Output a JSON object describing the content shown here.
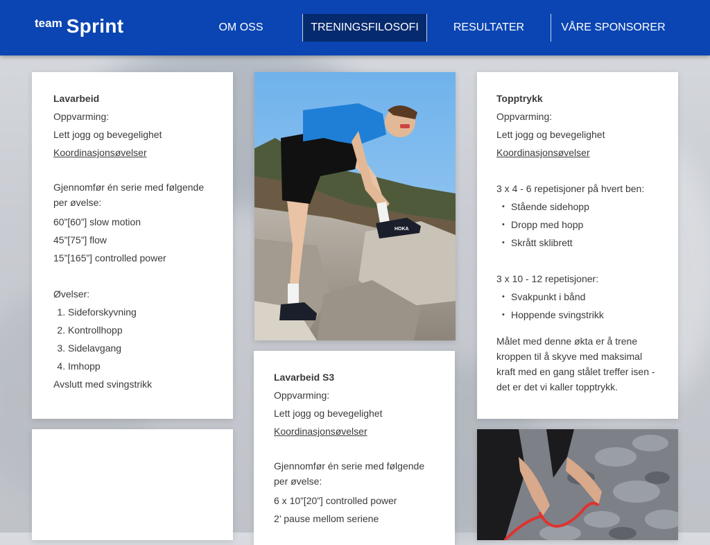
{
  "logo": {
    "team": "team",
    "sprint": "Sprint"
  },
  "nav": [
    {
      "label": "OM OSS"
    },
    {
      "label": "TRENINGSFILOSOFI"
    },
    {
      "label": "RESULTATER"
    },
    {
      "label": "VÅRE SPONSORER"
    }
  ],
  "card_left": {
    "title": "Lavarbeid",
    "warmup_label": "Oppvarming:",
    "warmup_text": "Lett jogg og bevegelighet",
    "link": "Koordinasjonsøvelser",
    "series_intro": "Gjennomfør én serie med følgende per øvelse:",
    "lines": [
      "60”[60”] slow motion",
      "45”[75”] flow",
      "15”[165”] controlled power"
    ],
    "exercises_label": "Øvelser:",
    "exercises": [
      "Sideforskyvning",
      "Kontrollhopp",
      "Sidelavgang",
      "Imhopp"
    ],
    "ending": "Avslutt med svingstrikk"
  },
  "card_right": {
    "title": "Topptrykk",
    "warmup_label": "Oppvarming:",
    "warmup_text": "Lett jogg og bevegelighet",
    "link": "Koordinasjonsøvelser",
    "set1_label": "3 x 4 - 6 repetisjoner på hvert ben:",
    "set1": [
      "Stående sidehopp",
      "Dropp med hopp",
      "Skrått sklibrett"
    ],
    "set2_label": "3 x 10 - 12 repetisjoner:",
    "set2": [
      "Svakpunkt i bånd",
      "Hoppende svingstrikk"
    ],
    "goal": "Målet med denne økta er å trene kroppen til å skyve med maksimal kraft med en gang stålet treffer isen - det er det vi kaller topptrykk."
  },
  "card_middle": {
    "title": "Lavarbeid S3",
    "warmup_label": "Oppvarming:",
    "warmup_text": "Lett jogg og bevegelighet",
    "link": "Koordinasjonsøvelser",
    "series_intro": "Gjennomfør én serie med følgende per øvelse:",
    "lines": [
      "6 x 10”[20”] controlled power",
      "2’ pause mellom seriene"
    ]
  },
  "shoe_brand": "HOKA",
  "colors": {
    "header": "#0b45b3",
    "nav_active": "#062a6e"
  }
}
